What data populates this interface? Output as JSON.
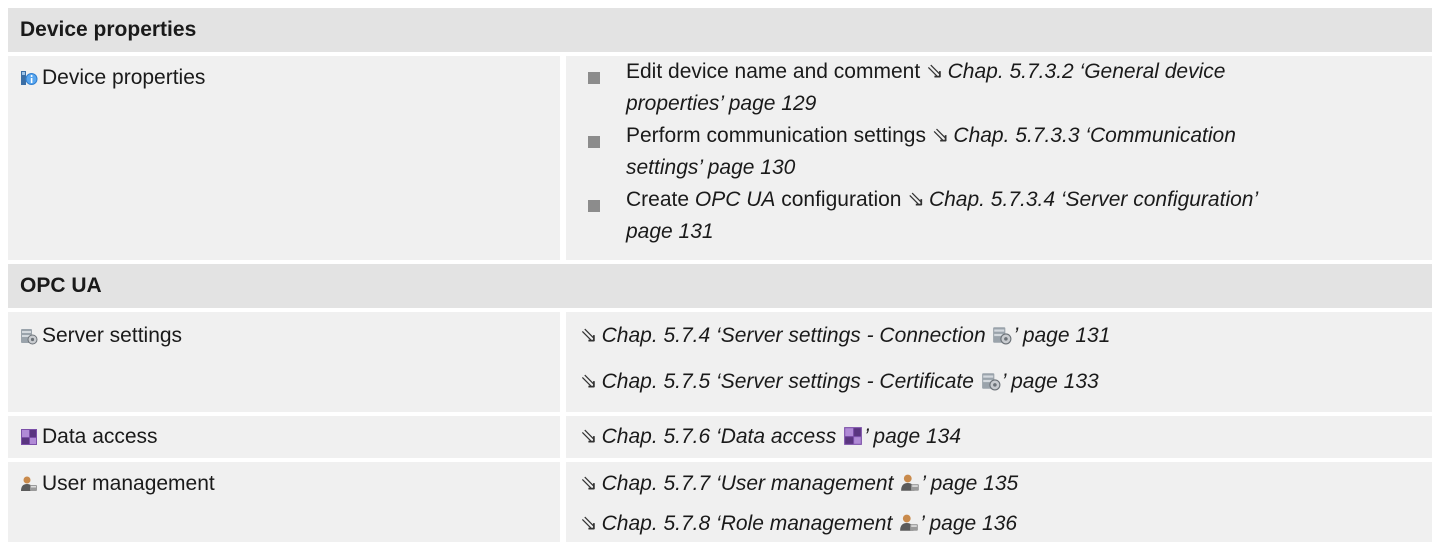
{
  "section1": {
    "title": "Device properties"
  },
  "device_properties_row": {
    "label": "Device properties",
    "icon": "device-info-icon",
    "items": [
      {
        "text": "Edit device name and comment",
        "ref_line1": "Chap. 5.7.3.2 ‘General device",
        "ref_line2": "properties’ page 129"
      },
      {
        "text": "Perform communication settings",
        "ref_line1": "Chap. 5.7.3.3 ‘Communication",
        "ref_line2": "settings’ page 130"
      },
      {
        "text_before": "Create",
        "text_italic": "OPC UA",
        "text_after": "configuration",
        "ref_line1": "Chap. 5.7.3.4 ‘Server configuration’",
        "ref_line2": "page 131"
      }
    ]
  },
  "section2": {
    "title": "OPC UA"
  },
  "server_settings_row": {
    "label": "Server settings",
    "icon": "server-settings-icon",
    "refs": [
      {
        "before": "Chap. 5.7.4 ‘Server settings - Connection ",
        "after": "’ page 131"
      },
      {
        "before": "Chap. 5.7.5 ‘Server settings - Certificate ",
        "after": "’ page 133"
      }
    ]
  },
  "data_access_row": {
    "label": "Data access",
    "icon": "opc-data-access-icon",
    "refs": [
      {
        "before": "Chap. 5.7.6 ‘Data access ",
        "after": "’ page 134"
      }
    ]
  },
  "user_management_row": {
    "label": "User management",
    "icon": "user-management-icon",
    "refs": [
      {
        "before": "Chap. 5.7.7 ‘User management ",
        "after": "’ page 135"
      },
      {
        "before": "Chap. 5.7.8 ‘Role management ",
        "after": "’ page 136"
      }
    ]
  }
}
